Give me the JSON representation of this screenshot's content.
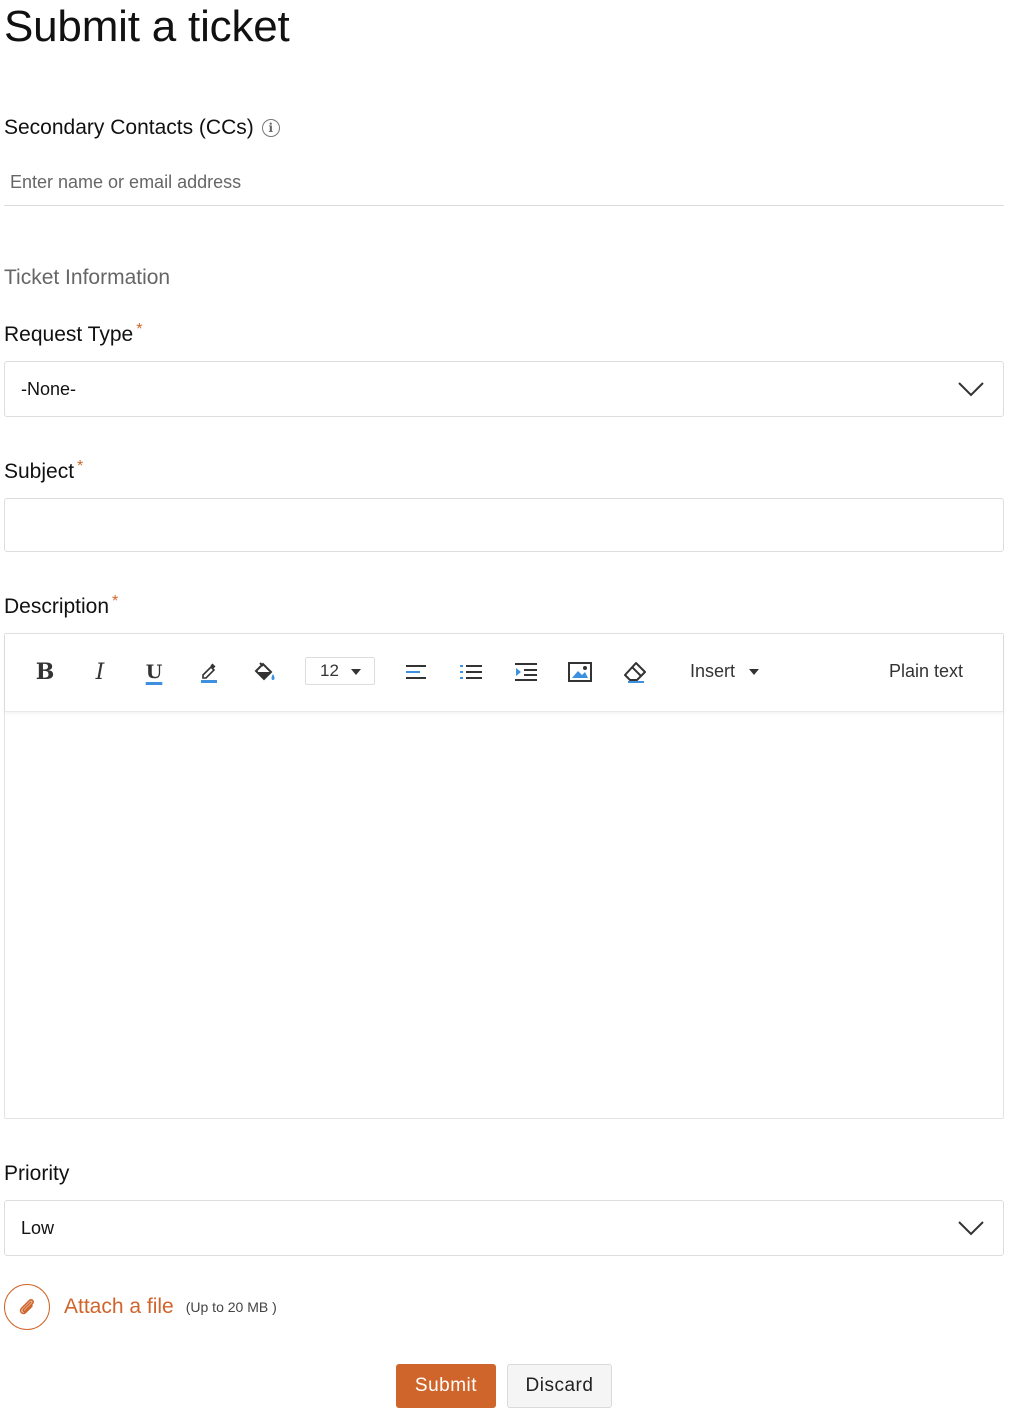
{
  "page": {
    "title": "Submit a ticket"
  },
  "cc": {
    "label": "Secondary Contacts (CCs)",
    "placeholder": "Enter name or email address"
  },
  "ticket_info": {
    "title": "Ticket Information",
    "required_mark": "*",
    "request_type": {
      "label": "Request Type",
      "value": "-None-"
    },
    "subject": {
      "label": "Subject",
      "value": ""
    },
    "description": {
      "label": "Description"
    },
    "priority": {
      "label": "Priority",
      "value": "Low"
    }
  },
  "editor": {
    "toolbar": {
      "bold": "B",
      "italic": "I",
      "underline": "U",
      "font_size": "12",
      "insert_label": "Insert",
      "plain_text_label": "Plain text"
    },
    "icons": [
      "bold-icon",
      "italic-icon",
      "underline-icon",
      "text-color-icon",
      "fill-color-icon",
      "align-left-icon",
      "bullet-list-icon",
      "indent-icon",
      "image-icon",
      "eraser-icon"
    ],
    "accent_color": "#3d8fe0"
  },
  "attach": {
    "label": "Attach a file",
    "note": "(Up to 20 MB )"
  },
  "actions": {
    "submit_label": "Submit",
    "discard_label": "Discard"
  },
  "colors": {
    "accent": "#d0652b",
    "icon_blue": "#3d8fe0"
  }
}
